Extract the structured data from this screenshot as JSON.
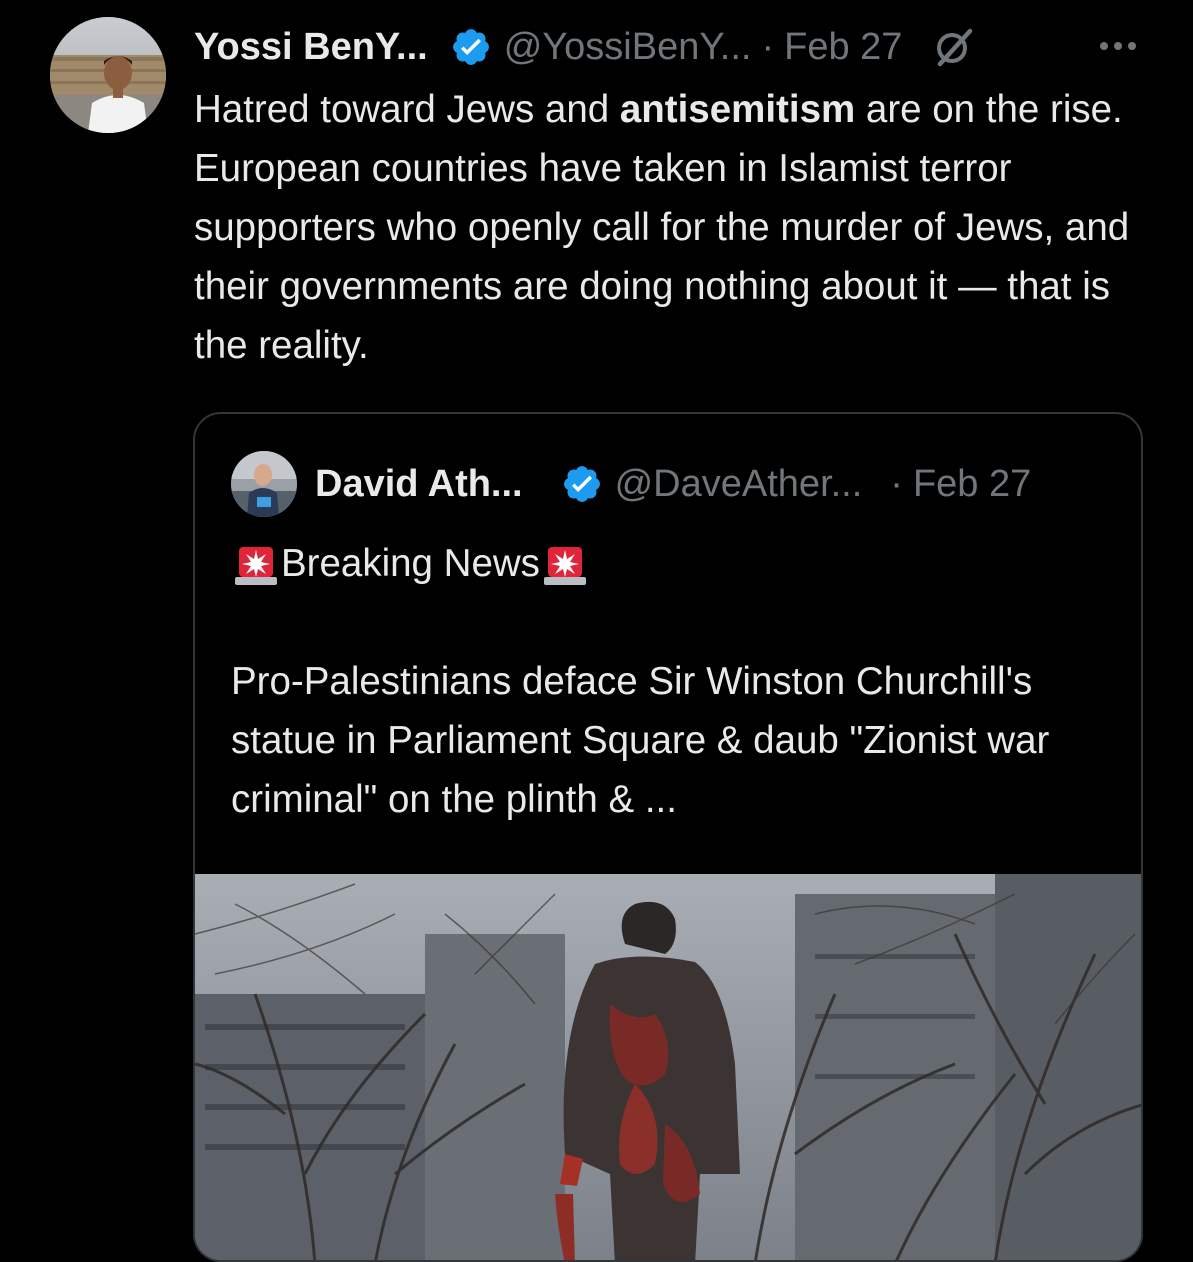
{
  "tweet": {
    "author_name": "Yossi BenY...",
    "handle": "@YossiBenY...",
    "separator": "·",
    "date": "Feb 27",
    "text_before": "Hatred toward Jews and ",
    "text_bold": "antisemitism",
    "text_after": " are on the rise. European countries have taken in Islamist terror supporters who openly call for the murder of Jews, and their governments are doing nothing about it — that is the reality.",
    "icons": {
      "verified": "verified-badge-icon",
      "grok": "grok-icon",
      "more": "more-options-icon"
    }
  },
  "quoted_tweet": {
    "author_name": "David Ath...",
    "handle": "@DaveAther...",
    "separator": "·",
    "date": "Feb 27",
    "headline": "Breaking News",
    "text": "Pro-Palestinians deface Sir Winston Churchill's statue in Parliament Square & daub \"Zionist war criminal\" on the plinth & ...",
    "media": "statue-photo",
    "icons": {
      "siren": "siren-icon"
    }
  },
  "colors": {
    "background": "#000000",
    "text_primary": "#e7e9ea",
    "text_secondary": "#71767b",
    "verified_blue": "#1d9bf0",
    "border": "#333639"
  }
}
